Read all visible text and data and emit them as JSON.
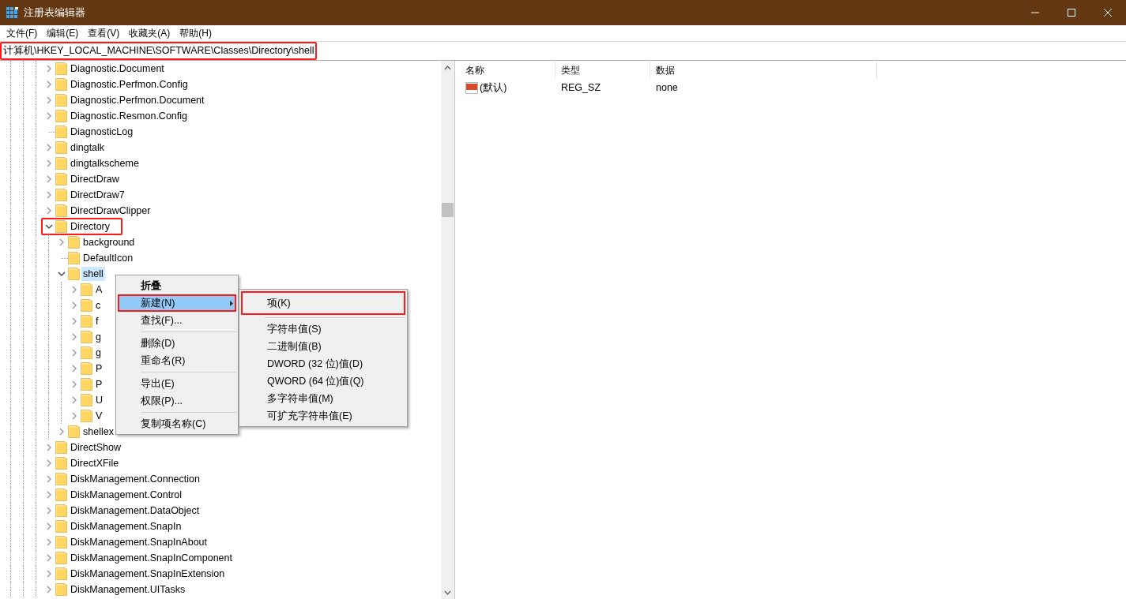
{
  "window": {
    "title": "注册表编辑器"
  },
  "menu_bar": [
    "文件(F)",
    "编辑(E)",
    "查看(V)",
    "收藏夹(A)",
    "帮助(H)"
  ],
  "address_bar": {
    "value": "计算机\\HKEY_LOCAL_MACHINE\\SOFTWARE\\Classes\\Directory\\shell",
    "highlighted": true
  },
  "tree": [
    {
      "label": "Diagnostic.Document",
      "expandable": true,
      "expanded": false,
      "selected": false,
      "highlighted": false
    },
    {
      "label": "Diagnostic.Perfmon.Config",
      "expandable": true,
      "expanded": false,
      "selected": false,
      "highlighted": false
    },
    {
      "label": "Diagnostic.Perfmon.Document",
      "expandable": true,
      "expanded": false,
      "selected": false,
      "highlighted": false
    },
    {
      "label": "Diagnostic.Resmon.Config",
      "expandable": true,
      "expanded": false,
      "selected": false,
      "highlighted": false
    },
    {
      "label": "DiagnosticLog",
      "expandable": false,
      "selected": false,
      "highlighted": false
    },
    {
      "label": "dingtalk",
      "expandable": true,
      "expanded": false,
      "selected": false,
      "highlighted": false
    },
    {
      "label": "dingtalkscheme",
      "expandable": true,
      "expanded": false,
      "selected": false,
      "highlighted": false
    },
    {
      "label": "DirectDraw",
      "expandable": true,
      "expanded": false,
      "selected": false,
      "highlighted": false
    },
    {
      "label": "DirectDraw7",
      "expandable": true,
      "expanded": false,
      "selected": false,
      "highlighted": false
    },
    {
      "label": "DirectDrawClipper",
      "expandable": true,
      "expanded": false,
      "selected": false,
      "highlighted": false
    },
    {
      "label": "Directory",
      "expandable": true,
      "expanded": true,
      "selected": false,
      "highlighted": true,
      "children": [
        {
          "label": "background",
          "expandable": true,
          "expanded": false,
          "selected": false,
          "highlighted": false
        },
        {
          "label": "DefaultIcon",
          "expandable": false,
          "selected": false,
          "highlighted": false
        },
        {
          "label": "shell",
          "expandable": true,
          "expanded": true,
          "selected": true,
          "highlighted": false,
          "children": [
            {
              "label": "A",
              "expandable": true,
              "expanded": false,
              "selected": false,
              "highlighted": false
            },
            {
              "label": "c",
              "expandable": true,
              "expanded": false,
              "selected": false,
              "highlighted": false
            },
            {
              "label": "f",
              "expandable": true,
              "expanded": false,
              "selected": false,
              "highlighted": false
            },
            {
              "label": "g",
              "expandable": true,
              "expanded": false,
              "selected": false,
              "highlighted": false
            },
            {
              "label": "g",
              "expandable": true,
              "expanded": false,
              "selected": false,
              "highlighted": false
            },
            {
              "label": "P",
              "expandable": true,
              "expanded": false,
              "selected": false,
              "highlighted": false
            },
            {
              "label": "P",
              "expandable": true,
              "expanded": false,
              "selected": false,
              "highlighted": false
            },
            {
              "label": "U",
              "expandable": true,
              "expanded": false,
              "selected": false,
              "highlighted": false
            },
            {
              "label": "V",
              "expandable": true,
              "expanded": false,
              "selected": false,
              "highlighted": false
            }
          ]
        },
        {
          "label": "shellex",
          "expandable": true,
          "expanded": false,
          "selected": false,
          "highlighted": false
        }
      ]
    },
    {
      "label": "DirectShow",
      "expandable": true,
      "expanded": false,
      "selected": false,
      "highlighted": false
    },
    {
      "label": "DirectXFile",
      "expandable": true,
      "expanded": false,
      "selected": false,
      "highlighted": false
    },
    {
      "label": "DiskManagement.Connection",
      "expandable": true,
      "expanded": false,
      "selected": false,
      "highlighted": false
    },
    {
      "label": "DiskManagement.Control",
      "expandable": true,
      "expanded": false,
      "selected": false,
      "highlighted": false
    },
    {
      "label": "DiskManagement.DataObject",
      "expandable": true,
      "expanded": false,
      "selected": false,
      "highlighted": false
    },
    {
      "label": "DiskManagement.SnapIn",
      "expandable": true,
      "expanded": false,
      "selected": false,
      "highlighted": false
    },
    {
      "label": "DiskManagement.SnapInAbout",
      "expandable": true,
      "expanded": false,
      "selected": false,
      "highlighted": false
    },
    {
      "label": "DiskManagement.SnapInComponent",
      "expandable": true,
      "expanded": false,
      "selected": false,
      "highlighted": false
    },
    {
      "label": "DiskManagement.SnapInExtension",
      "expandable": true,
      "expanded": false,
      "selected": false,
      "highlighted": false
    },
    {
      "label": "DiskManagement.UITasks",
      "expandable": true,
      "expanded": false,
      "selected": false,
      "highlighted": false
    }
  ],
  "context_menu": {
    "items": [
      {
        "kind": "item",
        "label": "折叠",
        "bold": true,
        "submenu": false,
        "selected": false,
        "highlighted": false
      },
      {
        "kind": "item",
        "label": "新建(N)",
        "bold": false,
        "submenu": true,
        "selected": true,
        "highlighted": true
      },
      {
        "kind": "item",
        "label": "查找(F)...",
        "bold": false,
        "submenu": false,
        "selected": false,
        "highlighted": false
      },
      {
        "kind": "separator"
      },
      {
        "kind": "item",
        "label": "删除(D)",
        "bold": false,
        "submenu": false,
        "selected": false,
        "highlighted": false
      },
      {
        "kind": "item",
        "label": "重命名(R)",
        "bold": false,
        "submenu": false,
        "selected": false,
        "highlighted": false
      },
      {
        "kind": "separator"
      },
      {
        "kind": "item",
        "label": "导出(E)",
        "bold": false,
        "submenu": false,
        "selected": false,
        "highlighted": false
      },
      {
        "kind": "item",
        "label": "权限(P)...",
        "bold": false,
        "submenu": false,
        "selected": false,
        "highlighted": false
      },
      {
        "kind": "separator"
      },
      {
        "kind": "item",
        "label": "复制项名称(C)",
        "bold": false,
        "submenu": false,
        "selected": false,
        "highlighted": false
      }
    ]
  },
  "submenu": {
    "items": [
      {
        "kind": "item",
        "label": "项(K)",
        "highlighted": true
      },
      {
        "kind": "separator"
      },
      {
        "kind": "item",
        "label": "字符串值(S)",
        "highlighted": false
      },
      {
        "kind": "item",
        "label": "二进制值(B)",
        "highlighted": false
      },
      {
        "kind": "item",
        "label": "DWORD (32 位)值(D)",
        "highlighted": false
      },
      {
        "kind": "item",
        "label": "QWORD (64 位)值(Q)",
        "highlighted": false
      },
      {
        "kind": "item",
        "label": "多字符串值(M)",
        "highlighted": false
      },
      {
        "kind": "item",
        "label": "可扩充字符串值(E)",
        "highlighted": false
      }
    ]
  },
  "values_table": {
    "columns": [
      "名称",
      "类型",
      "数据"
    ],
    "rows": [
      {
        "name": "(默认)",
        "type": "REG_SZ",
        "data": "none"
      }
    ]
  }
}
